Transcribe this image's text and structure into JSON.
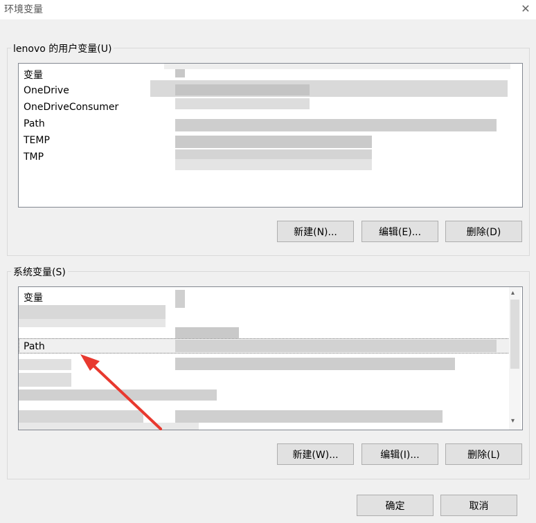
{
  "window": {
    "title": "环境变量",
    "close_glyph": "✕"
  },
  "user_group": {
    "legend": "lenovo 的用户变量(U)",
    "header": "变量",
    "rows": [
      "OneDrive",
      "OneDriveConsumer",
      "Path",
      "TEMP",
      "TMP"
    ],
    "buttons": {
      "new": "新建(N)...",
      "edit": "编辑(E)...",
      "delete": "删除(D)"
    }
  },
  "system_group": {
    "legend": "系统变量(S)",
    "header": "变量",
    "rows": [
      "Path"
    ],
    "buttons": {
      "new": "新建(W)...",
      "edit": "编辑(I)...",
      "delete": "删除(L)"
    },
    "scroll_up": "▴",
    "scroll_down": "▾"
  },
  "footer": {
    "ok": "确定",
    "cancel": "取消"
  },
  "colors": {
    "annotation_arrow": "#e8392f"
  }
}
